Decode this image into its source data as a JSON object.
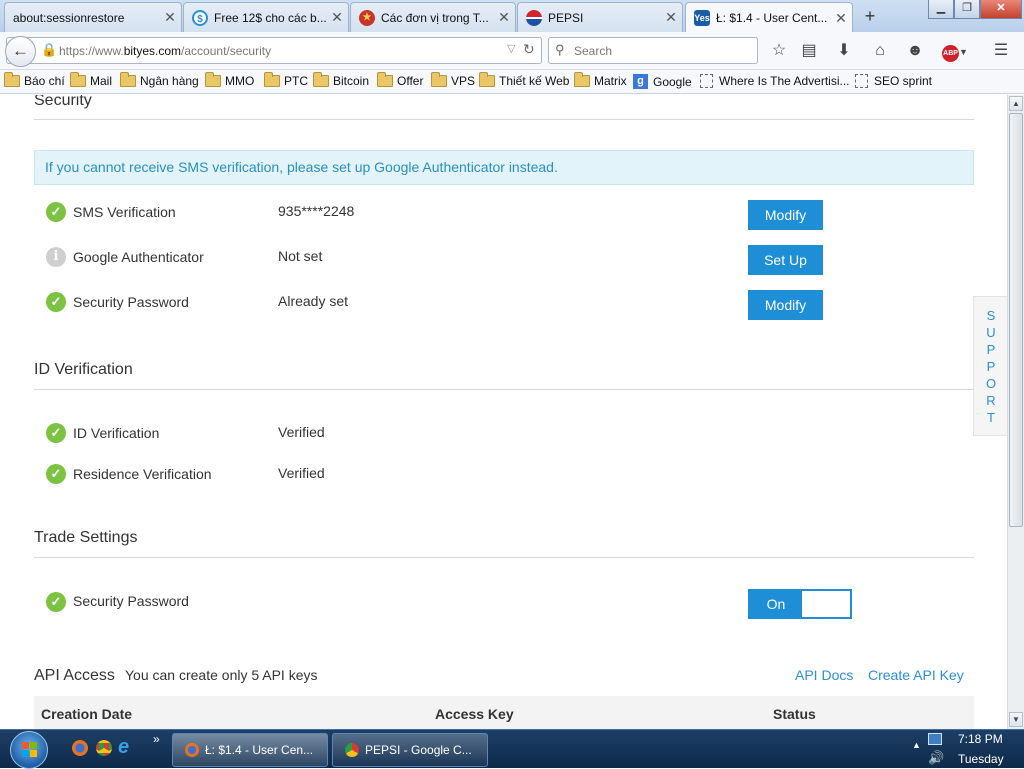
{
  "browser": {
    "tabs": [
      {
        "label": "about:sessionrestore",
        "icon": "blank-page-icon"
      },
      {
        "label": "Free 12$ cho các b...",
        "icon": "dollar-circle-icon"
      },
      {
        "label": "Các đơn vị trong T...",
        "icon": "emblem-icon"
      },
      {
        "label": "PEPSI",
        "icon": "pepsi-logo-icon"
      },
      {
        "label": "Ł: $1.4 - User Cent...",
        "icon": "bityes-icon",
        "active": true
      }
    ],
    "new_tab": "+",
    "url_prefix": "https://www.",
    "url_domain": "bityes.com",
    "url_path": "/account/security",
    "search_placeholder": "Search",
    "bookmarks": [
      "Báo chí",
      "Mail",
      "Ngân hàng",
      "MMO",
      "PTC",
      "Bitcoin",
      "Offer",
      "VPS",
      "Thiết kế Web",
      "Matrix",
      "Google",
      "Where Is The Advertisi...",
      "SEO sprint"
    ]
  },
  "security": {
    "title": "Security",
    "notice": "If you cannot receive SMS verification, please set up Google Authenticator instead.",
    "rows": [
      {
        "label": "SMS Verification",
        "value": "935****2248",
        "button": "Modify",
        "status": "ok"
      },
      {
        "label": "Google Authenticator",
        "value": "Not set",
        "button": "Set Up",
        "status": "info"
      },
      {
        "label": "Security Password",
        "value": "Already set",
        "button": "Modify",
        "status": "ok"
      }
    ]
  },
  "id_verification": {
    "title": "ID Verification",
    "rows": [
      {
        "label": "ID Verification",
        "value": "Verified"
      },
      {
        "label": "Residence Verification",
        "value": "Verified"
      }
    ]
  },
  "trade_settings": {
    "title": "Trade Settings",
    "row_label": "Security Password",
    "toggle_label": "On",
    "toggle_state": "on"
  },
  "api_access": {
    "title": "API Access",
    "subtitle": "You can create only 5 API keys",
    "docs_link": "API Docs",
    "create_link": "Create API Key",
    "columns": [
      "Creation Date",
      "Access Key",
      "Status"
    ]
  },
  "support_tab": "SUPPORT",
  "taskbar": {
    "items": [
      "Ł: $1.4 - User Cen...",
      "PEPSI - Google C..."
    ],
    "time": "7:18 PM",
    "day": "Tuesday"
  },
  "colors": {
    "accent": "#1e8fd6",
    "check": "#7cc243",
    "notice_bg": "#e3f3fa",
    "notice_text": "#2a8fbd"
  }
}
